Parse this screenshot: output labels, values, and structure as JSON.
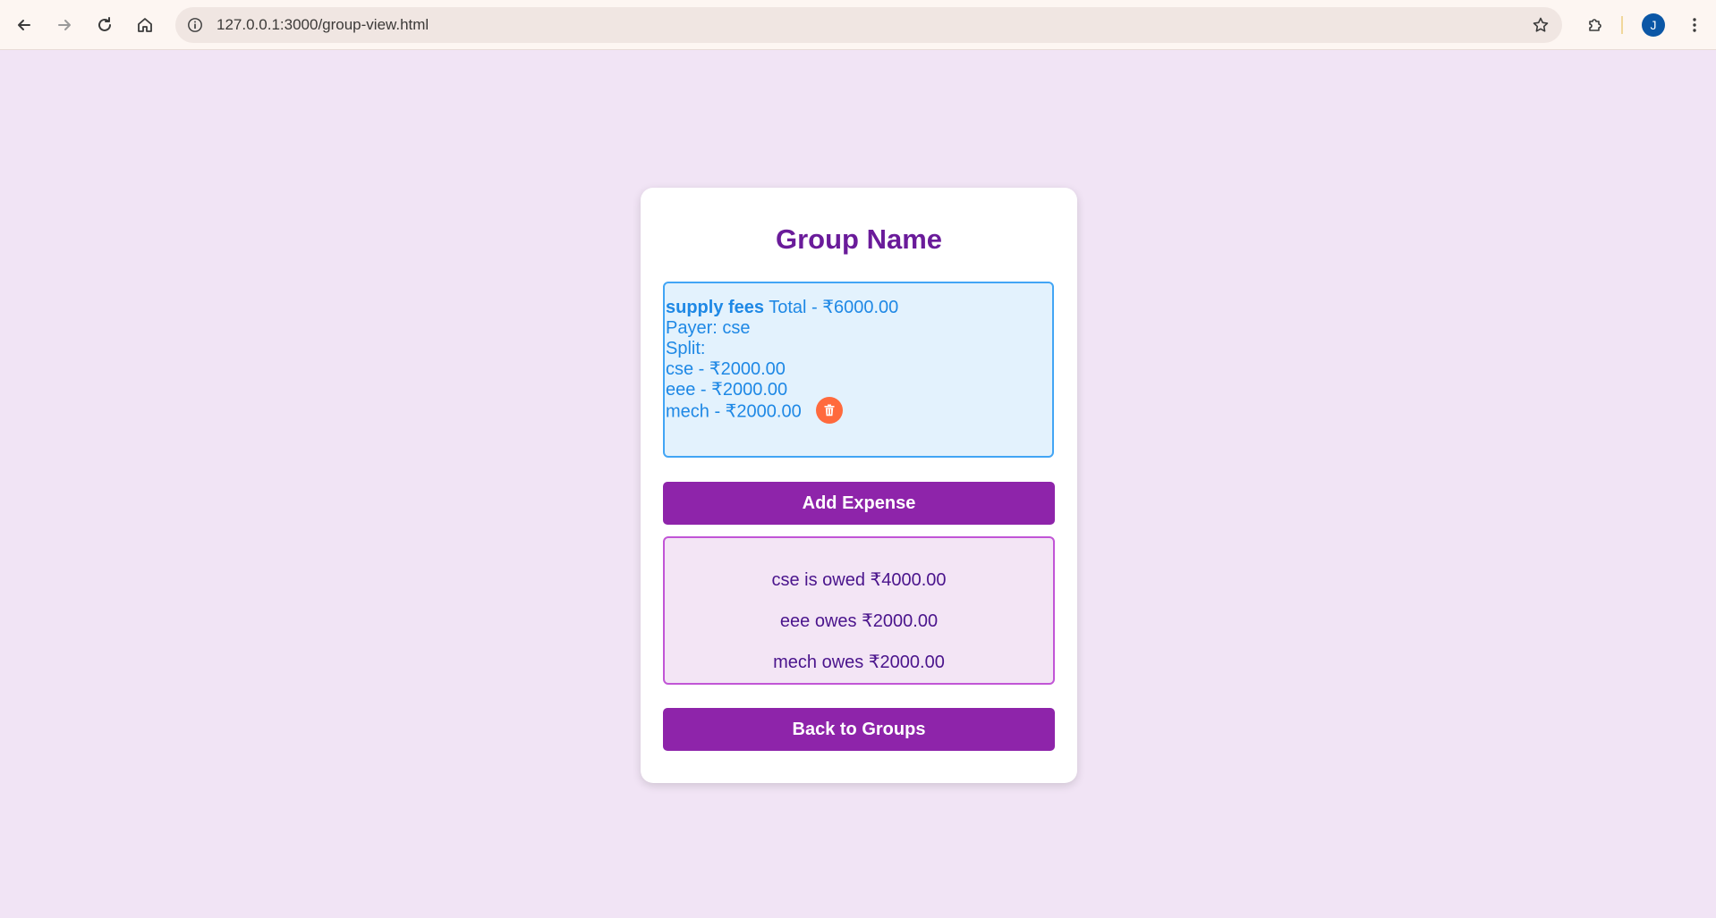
{
  "browser": {
    "url": "127.0.0.1:3000/group-view.html",
    "profile_initial": "J"
  },
  "group": {
    "title": "Group Name"
  },
  "expenses": [
    {
      "name": "supply fees",
      "total_text": "Total - ₹6000.00",
      "payer_text": "Payer: cse",
      "split_label": "Split:",
      "splits": [
        "cse - ₹2000.00",
        "eee - ₹2000.00",
        "mech - ₹2000.00"
      ],
      "delete_icon": "trash-icon"
    }
  ],
  "buttons": {
    "add_expense": "Add Expense",
    "back_to_groups": "Back to Groups"
  },
  "balances": [
    "cse is owed ₹4000.00",
    "eee owes ₹2000.00",
    "mech owes ₹2000.00"
  ],
  "colors": {
    "page_bg": "#f1e4f5",
    "title": "#6a1b9a",
    "button": "#8e24aa",
    "expense_bg": "#e3f2fd",
    "expense_border": "#42a5f5",
    "expense_text": "#1e88e5",
    "delete": "#ff6a3d",
    "balance_border": "#c155d6",
    "balance_text": "#4a148c"
  }
}
